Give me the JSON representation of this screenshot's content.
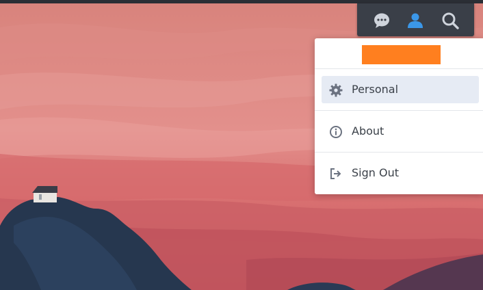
{
  "taskbar": {
    "buttons": [
      {
        "id": "notifications",
        "icon": "chat-bubble-icon",
        "color": "#cfd4dc"
      },
      {
        "id": "user",
        "icon": "user-icon",
        "color": "#3b97e8",
        "active": true
      },
      {
        "id": "search",
        "icon": "search-icon",
        "color": "#cfd4dc"
      }
    ]
  },
  "user_menu": {
    "username_redacted_color": "#ff7f1f",
    "items": [
      {
        "label": "Personal",
        "icon": "gear-icon",
        "selected": true
      },
      {
        "label": "About",
        "icon": "info-icon",
        "selected": false
      },
      {
        "label": "Sign Out",
        "icon": "sign-out-icon",
        "selected": false
      }
    ]
  },
  "colors": {
    "tray_bg": "#3a3f48",
    "menu_bg": "#ffffff",
    "menu_selected_bg": "#e6ebf4",
    "menu_text": "#3b4149",
    "menu_icon": "#6b7280",
    "sky_top": "#d87c78",
    "mountain": "#26374f"
  }
}
